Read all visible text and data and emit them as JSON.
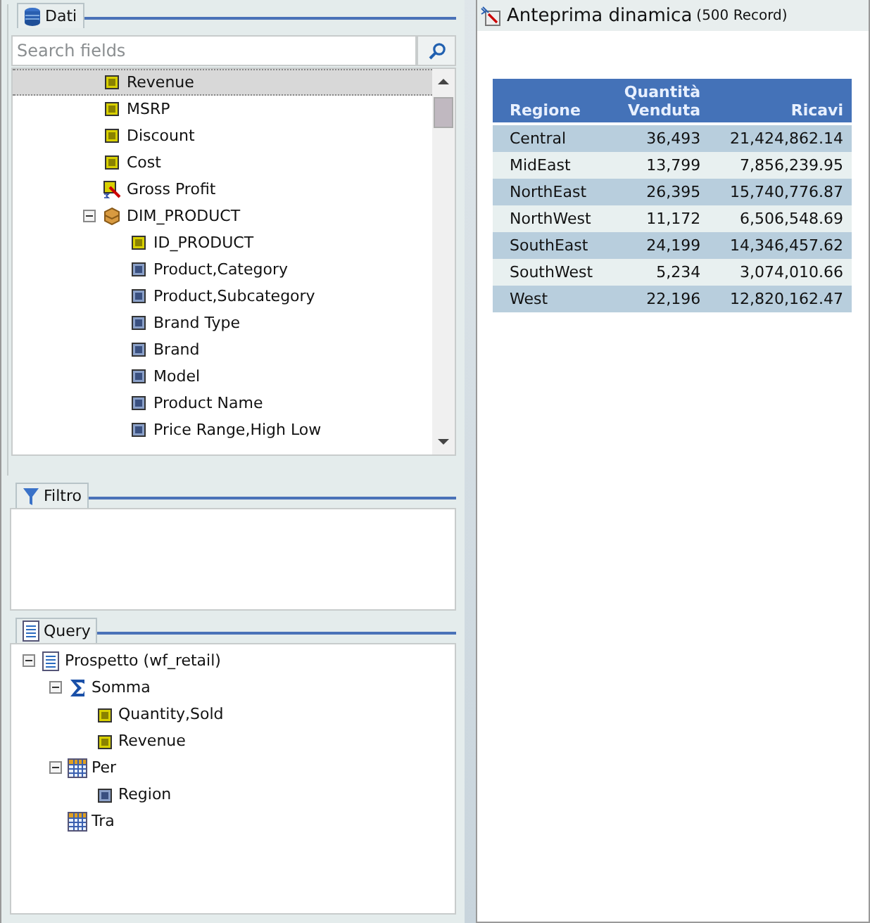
{
  "data_panel": {
    "title": "Dati",
    "search": {
      "placeholder": "Search fields"
    },
    "tree": [
      {
        "label": "Revenue",
        "kind": "measure",
        "selected": true
      },
      {
        "label": "MSRP",
        "kind": "measure",
        "selected": false
      },
      {
        "label": "Discount",
        "kind": "measure",
        "selected": false
      },
      {
        "label": "Cost",
        "kind": "measure",
        "selected": false
      },
      {
        "label": "Gross Profit",
        "kind": "computed",
        "selected": false
      },
      {
        "label": "DIM_PRODUCT",
        "kind": "folder",
        "selected": false,
        "expanded": true,
        "children": [
          {
            "label": "ID_PRODUCT",
            "kind": "measure",
            "selected": false
          },
          {
            "label": "Product,Category",
            "kind": "dimension",
            "selected": false
          },
          {
            "label": "Product,Subcategory",
            "kind": "dimension",
            "selected": false
          },
          {
            "label": "Brand Type",
            "kind": "dimension",
            "selected": false
          },
          {
            "label": "Brand",
            "kind": "dimension",
            "selected": false
          },
          {
            "label": "Model",
            "kind": "dimension",
            "selected": false
          },
          {
            "label": "Product Name",
            "kind": "dimension",
            "selected": false
          },
          {
            "label": "Price Range,High Low",
            "kind": "dimension",
            "selected": false
          }
        ]
      }
    ]
  },
  "filter_panel": {
    "title": "Filtro"
  },
  "query_panel": {
    "title": "Query",
    "tree": [
      {
        "label": "Prospetto (wf_retail)",
        "kind": "report",
        "expanded": true,
        "children": [
          {
            "label": "Somma",
            "kind": "sum",
            "expanded": true,
            "children": [
              {
                "label": "Quantity,Sold",
                "kind": "measure"
              },
              {
                "label": "Revenue",
                "kind": "measure"
              }
            ]
          },
          {
            "label": "Per",
            "kind": "grid",
            "expanded": true,
            "children": [
              {
                "label": "Region",
                "kind": "dimension"
              }
            ]
          },
          {
            "label": "Tra",
            "kind": "grid"
          }
        ]
      }
    ]
  },
  "preview": {
    "title": "Anteprima dinamica",
    "count": "(500 Record)",
    "table": {
      "columns": [
        {
          "lines": [
            "Regione"
          ]
        },
        {
          "lines": [
            "Quantità",
            "Venduta"
          ]
        },
        {
          "lines": [
            "Ricavi"
          ]
        }
      ],
      "rows": [
        [
          "Central",
          "36,493",
          "21,424,862.14"
        ],
        [
          "MidEast",
          "13,799",
          "7,856,239.95"
        ],
        [
          "NorthEast",
          "26,395",
          "15,740,776.87"
        ],
        [
          "NorthWest",
          "11,172",
          "6,506,548.69"
        ],
        [
          "SouthEast",
          "24,199",
          "14,346,457.62"
        ],
        [
          "SouthWest",
          "5,234",
          "3,074,010.66"
        ],
        [
          "West",
          "22,196",
          "12,820,162.47"
        ]
      ]
    }
  }
}
